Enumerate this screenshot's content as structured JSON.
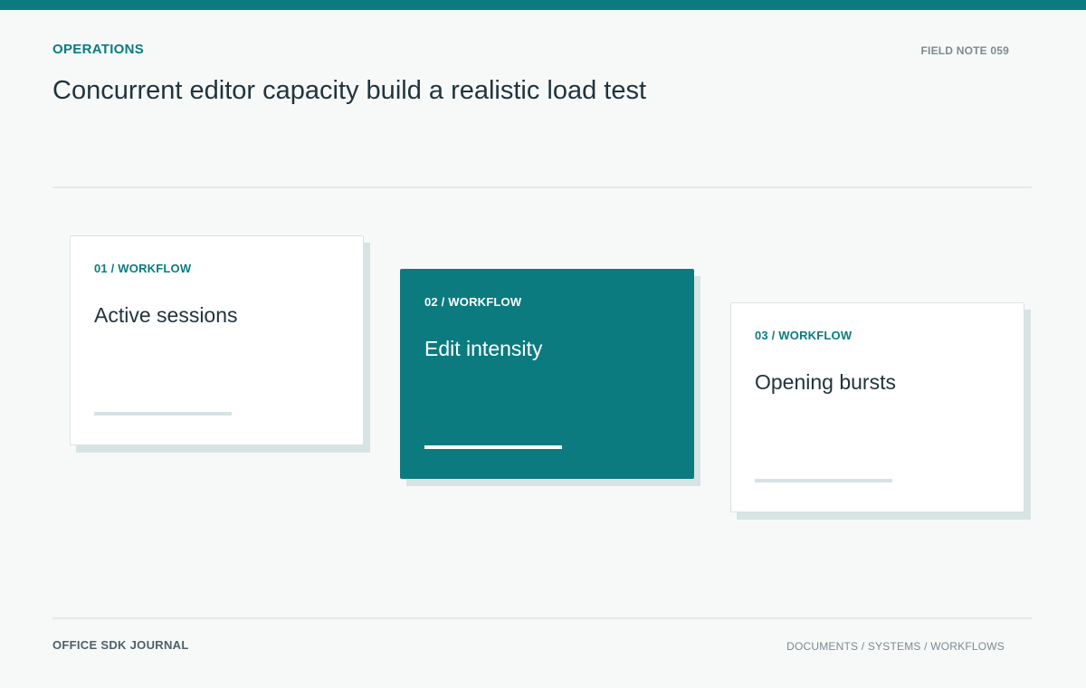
{
  "header": {
    "section_label": "OPERATIONS",
    "field_note": "FIELD NOTE 059",
    "title": "Concurrent editor capacity build a realistic load test"
  },
  "cards": [
    {
      "eyebrow": "01 / WORKFLOW",
      "title": "Active sessions"
    },
    {
      "eyebrow": "02 / WORKFLOW",
      "title": "Edit intensity"
    },
    {
      "eyebrow": "03 / WORKFLOW",
      "title": "Opening bursts"
    }
  ],
  "footer": {
    "brand": "OFFICE SDK JOURNAL",
    "breadcrumb": "DOCUMENTS / SYSTEMS / WORKFLOWS"
  },
  "colors": {
    "accent": "#0b7b80",
    "background": "#f7f9f9",
    "text": "#22343d"
  }
}
